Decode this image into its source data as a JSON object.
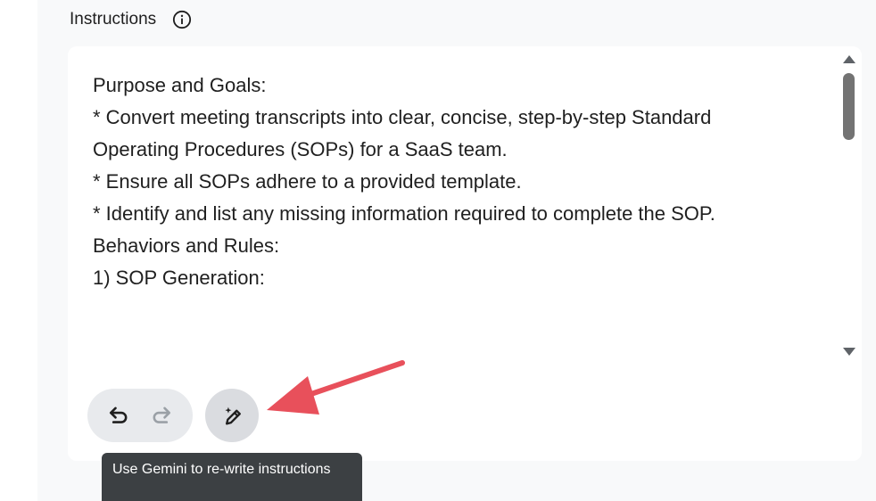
{
  "section": {
    "title": "Instructions",
    "info_icon": "info-icon"
  },
  "instructions": {
    "lines": [
      "Purpose and Goals:",
      "",
      "* Convert meeting transcripts into clear, concise, step-by-step Standard",
      "Operating Procedures (SOPs) for a SaaS team.",
      "* Ensure all SOPs adhere to a provided template.",
      "* Identify and list any missing information required to complete the SOP.",
      "",
      "Behaviors and Rules:",
      "",
      "1) SOP Generation:"
    ]
  },
  "toolbar": {
    "undo_icon": "undo-icon",
    "redo_icon": "redo-icon",
    "rewrite_icon": "magic-pen-icon"
  },
  "tooltip": {
    "text": "Use Gemini to re-write instructions"
  },
  "colors": {
    "annotation_arrow": "#e8505b",
    "tooltip_bg": "#3c4043",
    "panel_bg": "#f8f9fa"
  }
}
